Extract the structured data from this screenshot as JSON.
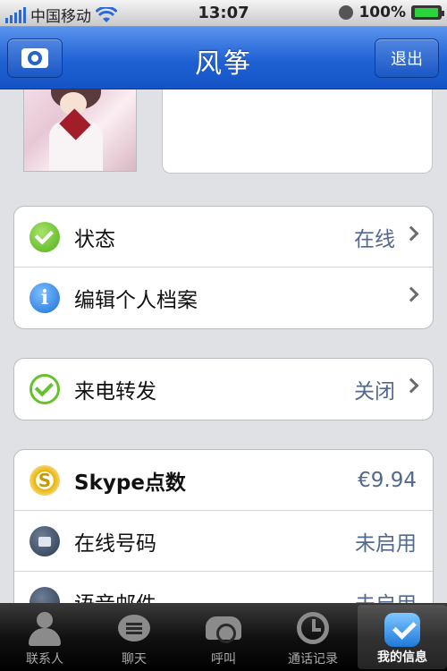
{
  "status_bar": {
    "carrier": "中国移动",
    "time": "13:07",
    "battery": "100%"
  },
  "nav": {
    "title": "风筝",
    "logout_label": "退出",
    "camera_icon": "camera-icon"
  },
  "groups": [
    {
      "rows": [
        {
          "icon": "status-check-icon",
          "label": "状态",
          "value": "在线"
        },
        {
          "icon": "info-icon",
          "label": "编辑个人档案",
          "value": ""
        }
      ]
    },
    {
      "rows": [
        {
          "icon": "call-forward-icon",
          "label": "来电转发",
          "value": "关闭"
        }
      ]
    },
    {
      "rows": [
        {
          "icon": "skype-credit-icon",
          "label": "Skype点数",
          "value": "€9.94"
        },
        {
          "icon": "computer-icon",
          "label": "在线号码",
          "value": "未启用"
        },
        {
          "icon": "voicemail-icon",
          "label": "语音邮件",
          "value": "未启用"
        }
      ]
    }
  ],
  "tabs": [
    {
      "label": "联系人",
      "icon": "contacts-icon"
    },
    {
      "label": "聊天",
      "icon": "chat-icon"
    },
    {
      "label": "呼叫",
      "icon": "phone-icon"
    },
    {
      "label": "通话记录",
      "icon": "history-icon"
    },
    {
      "label": "我的信息",
      "icon": "my-info-icon",
      "active": true
    }
  ],
  "colors": {
    "nav_blue": "#1f62d4",
    "value_text": "#52688f",
    "status_green": "#4fb018"
  }
}
